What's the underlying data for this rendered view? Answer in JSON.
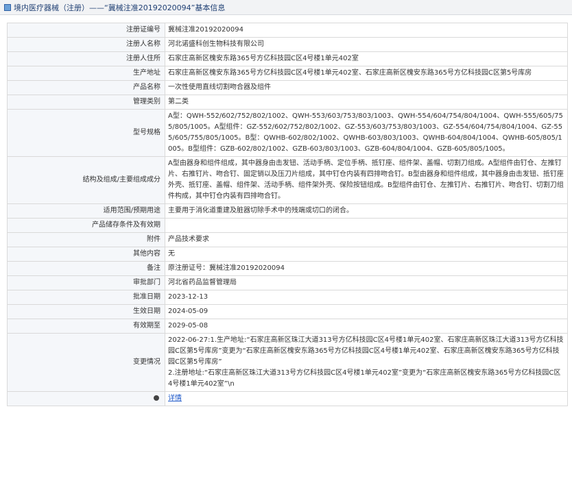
{
  "header": {
    "title": "境内医疗器械（注册）——“冀械注准20192020094”基本信息"
  },
  "rows": [
    {
      "k": "注册证编号",
      "v": "冀械注准20192020094"
    },
    {
      "k": "注册人名称",
      "v": "河北诺盛科创生物科技有限公司"
    },
    {
      "k": "注册人住所",
      "v": "石家庄高新区槐安东路365号方亿科技园C区4号楼1单元402室"
    },
    {
      "k": "生产地址",
      "v": "石家庄高新区槐安东路365号方亿科技园C区4号楼1单元402室、石家庄高新区槐安东路365号方亿科技园C区第5号库房"
    },
    {
      "k": "产品名称",
      "v": "一次性使用直线切割吻合器及组件"
    },
    {
      "k": "管理类别",
      "v": "第二类"
    },
    {
      "k": "型号规格",
      "v": "A型：QWH-552/602/752/802/1002、QWH-553/603/753/803/1003、QWH-554/604/754/804/1004、QWH-555/605/755/805/1005。A型组件：GZ-552/602/752/802/1002、GZ-553/603/753/803/1003、GZ-554/604/754/804/1004、GZ-555/605/755/805/1005。B型：QWHB-602/802/1002、QWHB-603/803/1003、QWHB-604/804/1004、QWHB-605/805/1005。B型组件：GZB-602/802/1002、GZB-603/803/1003、GZB-604/804/1004、GZB-605/805/1005。"
    },
    {
      "k": "结构及组成/主要组成成分",
      "v": "A型由器身和组件组成，其中器身由击发钮、活动手柄、定位手柄、抵钉座、组件架、盖帽、切割刀组成。A型组件由钉仓、左推钉片、右推钉片、吻合钉、固定销以及压刀片组成，其中钉仓内装有四排吻合钉。B型由器身和组件组成，其中器身由击发钮、抵钉座外壳、抵钉座、盖帽、组件架、活动手柄、组件架外壳、保险按钮组成。B型组件由钉仓、左推钉片、右推钉片、吻合钉、切割刀组件构成，其中钉仓内装有四排吻合钉。"
    },
    {
      "k": "适用范围/预期用途",
      "v": "主要用于消化道重建及脏器切除手术中的残端或切口的闭合。"
    },
    {
      "k": "产品储存条件及有效期",
      "v": ""
    },
    {
      "k": "附件",
      "v": "产品技术要求"
    },
    {
      "k": "其他内容",
      "v": "无"
    },
    {
      "k": "备注",
      "v": "原注册证号：冀械注准20192020094"
    },
    {
      "k": "审批部门",
      "v": "河北省药品监督管理局"
    },
    {
      "k": "批准日期",
      "v": "2023-12-13"
    },
    {
      "k": "生效日期",
      "v": "2024-05-09"
    },
    {
      "k": "有效期至",
      "v": "2029-05-08"
    },
    {
      "k": "变更情况",
      "v": "2022-06-27:1.生产地址:“石家庄高新区珠江大道313号方亿科技园C区4号楼1单元402室、石家庄高新区珠江大道313号方亿科技园C区第5号库房”变更为“石家庄高新区槐安东路365号方亿科技园C区4号楼1单元402室、石家庄高新区槐安东路365号方亿科技园C区第5号库房”",
      "v2": "2.注册地址:“石家庄高新区珠江大道313号方亿科技园C区4号楼1单元402室”变更为“石家庄高新区槐安东路365号方亿科技园C区4号楼1单元402室”\\n"
    }
  ],
  "footer": {
    "detail_label": "详情"
  }
}
